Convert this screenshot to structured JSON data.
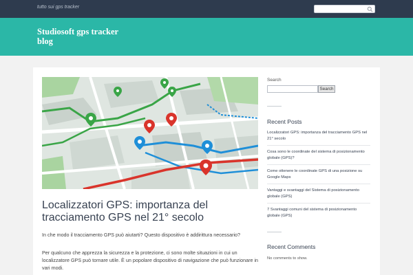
{
  "topbar": {
    "tagline": "tutto sui gps tracker"
  },
  "header": {
    "site_title": "Studiosoft gps tracker blog"
  },
  "post": {
    "title": "Localizzatori GPS: importanza del tracciamento GPS nel 21° secolo",
    "paragraphs": [
      "In che modo il tracciamento GPS può aiutarti? Questo dispositivo è addirittura necessario?",
      "Per qualcuno che apprezza la sicurezza e la protezione, ci sono molte situazioni in cui un localizzatore GPS può tornare utile. È un popolare dispositivo di navigazione che può funzionare in vari modi."
    ]
  },
  "sidebar": {
    "search_label": "Search",
    "search_button": "Search",
    "recent_posts_title": "Recent Posts",
    "recent_posts": [
      "Localizzatori GPS: importanza del tracciamento GPS nel 21° secolo",
      "Cosa sono le coordinate del sistema di posizionamento globale (GPS)?",
      "Come ottenere le coordinate GPS di una posizione su Google Maps",
      "Vantaggi e svantaggi del Sistema di posizionamento globale (GPS)",
      "7 Svantaggi comuni del sistema di posizionamento globale (GPS)"
    ],
    "recent_comments_title": "Recent Comments",
    "no_comments": "No comments to show."
  },
  "colors": {
    "topbar": "#2e3b4e",
    "header": "#2bb7a7",
    "pin_green": "#3aa547",
    "pin_red": "#d9342b",
    "pin_blue": "#1f8fd8"
  }
}
